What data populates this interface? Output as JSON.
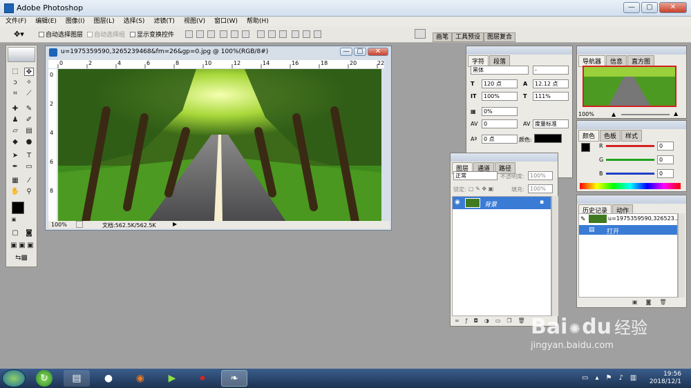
{
  "window": {
    "title": "Adobe Photoshop",
    "buttons": [
      "—",
      "▢",
      "✕"
    ]
  },
  "menu": [
    "文件(F)",
    "编辑(E)",
    "图像(I)",
    "图层(L)",
    "选择(S)",
    "滤镜(T)",
    "视图(V)",
    "窗口(W)",
    "帮助(H)"
  ],
  "options": {
    "auto_select_layer": "自动选择图层",
    "auto_select_group": "自动选择组",
    "show_transform": "显示变换控件",
    "tabs": [
      "画笔",
      "工具预设",
      "图层复合"
    ]
  },
  "document": {
    "title": "u=1975359590,3265239468&fm=26&gp=0.jpg @ 100%(RGB/8#)",
    "ruler_h": [
      "0",
      "2",
      "4",
      "6",
      "8",
      "10",
      "12",
      "14",
      "16",
      "18",
      "20",
      "22"
    ],
    "ruler_v": [
      "0",
      "2",
      "4",
      "6",
      "8"
    ],
    "zoom": "100%",
    "doc_info": "文档:562.5K/562.5K"
  },
  "character": {
    "tabs": [
      "字符",
      "段落"
    ],
    "font": "黑体",
    "style": "-",
    "size": "120 点",
    "leading": "12.12 点",
    "vscale": "100%",
    "hscale": "111%",
    "tracking_pct": "0%",
    "kerning": "0",
    "kerning_mode": "度量标准",
    "baseline": "0 点",
    "color_label": "颜色:"
  },
  "layers": {
    "tabs": [
      "图层",
      "通道",
      "路径"
    ],
    "blend": "正常",
    "opacity_label": "不透明度:",
    "opacity": "100%",
    "lock_label": "锁定:",
    "fill_label": "填充:",
    "fill": "100%",
    "layer_name": "背景"
  },
  "navigator": {
    "tabs": [
      "导航器",
      "信息",
      "直方图"
    ],
    "zoom": "100%"
  },
  "color": {
    "tabs": [
      "颜色",
      "色板",
      "样式"
    ],
    "channels": [
      {
        "label": "R",
        "value": "0"
      },
      {
        "label": "G",
        "value": "0"
      },
      {
        "label": "B",
        "value": "0"
      }
    ]
  },
  "history": {
    "tabs": [
      "历史记录",
      "动作"
    ],
    "snapshot": "u=1975359590,326523...",
    "step": "打开"
  },
  "taskbar": {
    "time": "19:56",
    "date": "2018/12/1"
  },
  "watermark": {
    "brand": "Bai",
    "brand2": "du",
    "cn": "经验",
    "url": "jingyan.baidu.com"
  },
  "colors": {
    "accent": "#3a7bd5",
    "red": "#d42020",
    "green": "#1ea21e",
    "blue": "#2040c8"
  }
}
